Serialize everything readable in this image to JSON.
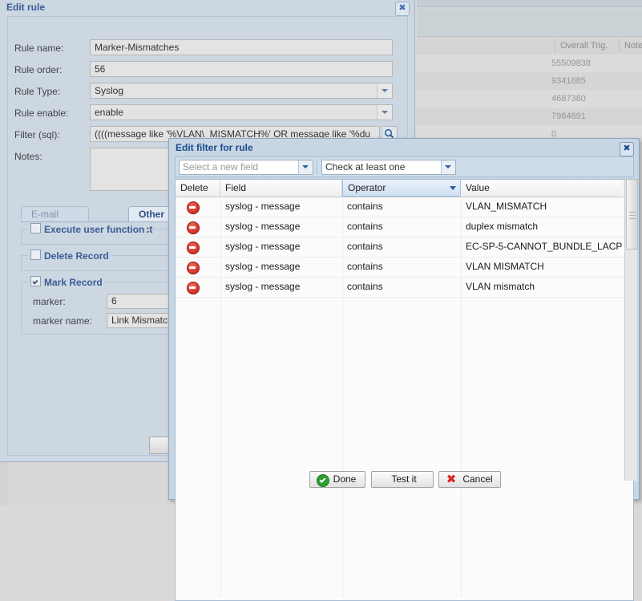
{
  "background_grid": {
    "columns": [
      "Overall Trig.",
      "Note"
    ],
    "rows": [
      "55509838",
      "9341685",
      "4687380",
      "7984891",
      "0"
    ]
  },
  "edit_rule_window": {
    "title": "Edit rule",
    "close_label": "✖",
    "fields": [
      {
        "label": "Rule name:",
        "value": "Marker-Mismatches"
      },
      {
        "label": "Rule order:",
        "value": "56"
      },
      {
        "label": "Rule Type:",
        "value": "Syslog"
      },
      {
        "label": "Rule enable:",
        "value": "enable"
      },
      {
        "label": "Filter (sql):",
        "value": "((((message like '%VLAN\\_MISMATCH%'  OR message like '%du"
      },
      {
        "label": "Notes:",
        "value": ""
      }
    ],
    "sql_search_icon": "magnifier-icon",
    "tabs": [
      {
        "label": "E-mail Notification",
        "active": false
      },
      {
        "label": "Other act",
        "active": true
      }
    ],
    "groups": [
      {
        "label": "Execute user function",
        "checked": false
      },
      {
        "label": "Delete Record",
        "checked": false
      },
      {
        "label": "Mark Record",
        "checked": true
      }
    ],
    "mark_record": {
      "marker_label": "marker:",
      "marker_value": "6",
      "marker_name_label": "marker name:",
      "marker_name_value": "Link Mismatch"
    }
  },
  "filter_dialog": {
    "title": "Edit filter for rule",
    "close_label": "✖",
    "toolbar": {
      "field_select_placeholder": "Select a new field",
      "match_select_value": "Check at least one"
    },
    "grid": {
      "columns": [
        "Delete",
        "Field",
        "Operator",
        "Value"
      ],
      "active_column": "Operator",
      "rows": [
        {
          "delete_icon": "remove-icon",
          "field": "syslog - message",
          "operator": "contains",
          "value": "VLAN_MISMATCH"
        },
        {
          "delete_icon": "remove-icon",
          "field": "syslog - message",
          "operator": "contains",
          "value": "duplex mismatch"
        },
        {
          "delete_icon": "remove-icon",
          "field": "syslog - message",
          "operator": "contains",
          "value": "EC-SP-5-CANNOT_BUNDLE_LACP"
        },
        {
          "delete_icon": "remove-icon",
          "field": "syslog - message",
          "operator": "contains",
          "value": "VLAN MISMATCH"
        },
        {
          "delete_icon": "remove-icon",
          "field": "syslog - message",
          "operator": "contains",
          "value": "VLAN mismatch"
        }
      ]
    },
    "buttons": [
      {
        "label": "Done",
        "icon": "green-check-icon"
      },
      {
        "label": "Test it",
        "icon": "none"
      },
      {
        "label": "Cancel",
        "icon": "red-cross-icon"
      }
    ]
  },
  "colors": {
    "dialog_bg": "#c6d6e3",
    "window_bg": "#ccd7e2",
    "title_text": "#1e4b8f",
    "accent_border": "#8ea7c2",
    "delete_icon": "#d8372a",
    "done_icon": "#2f9e2f",
    "cancel_icon": "#dd2222"
  }
}
